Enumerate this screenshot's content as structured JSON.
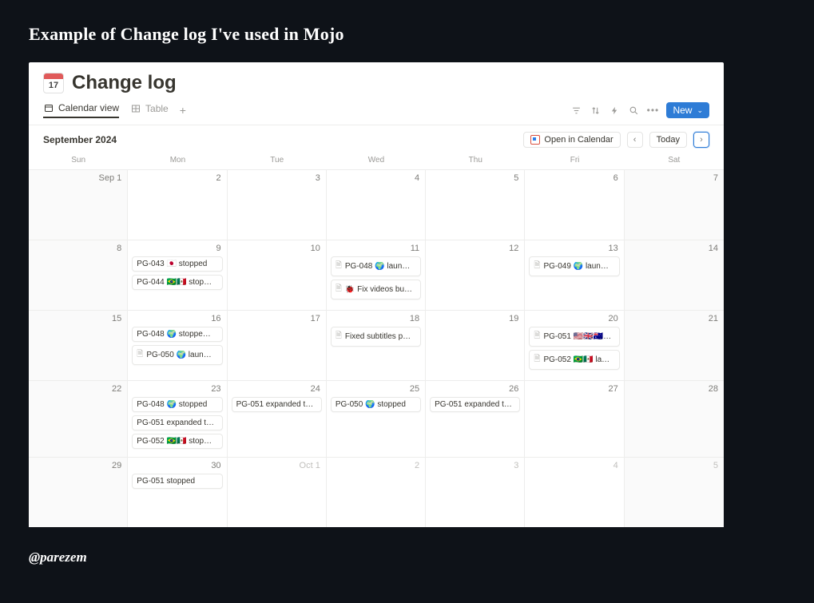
{
  "slide": {
    "title": "Example of Change log I've used in Mojo",
    "handle": "@parezem"
  },
  "page": {
    "icon_day": "17",
    "title": "Change log"
  },
  "views": {
    "calendar": "Calendar view",
    "table": "Table",
    "new_button": "New"
  },
  "toolbar": {
    "open_in_calendar": "Open in Calendar",
    "today": "Today"
  },
  "month": {
    "label": "September 2024"
  },
  "dows": [
    "Sun",
    "Mon",
    "Tue",
    "Wed",
    "Thu",
    "Fri",
    "Sat"
  ],
  "weeks": [
    {
      "days": [
        {
          "label": "Sep 1",
          "we": true,
          "events": []
        },
        {
          "label": "2",
          "events": []
        },
        {
          "label": "3",
          "events": []
        },
        {
          "label": "4",
          "events": []
        },
        {
          "label": "5",
          "events": []
        },
        {
          "label": "6",
          "events": []
        },
        {
          "label": "7",
          "we": true,
          "events": []
        }
      ]
    },
    {
      "days": [
        {
          "label": "8",
          "we": true,
          "events": []
        },
        {
          "label": "9",
          "events": [
            {
              "text": "PG-043 🇯🇵 stopped"
            },
            {
              "text": "PG-044 🇧🇷🇲🇽 stop…"
            }
          ]
        },
        {
          "label": "10",
          "events": []
        },
        {
          "label": "11",
          "events": [
            {
              "icon": true,
              "text": "PG-048 🌍 laun…"
            },
            {
              "icon": true,
              "text": "🐞 Fix videos bu…"
            }
          ]
        },
        {
          "label": "12",
          "events": []
        },
        {
          "label": "13",
          "events": [
            {
              "icon": true,
              "text": "PG-049 🌍 laun…"
            }
          ]
        },
        {
          "label": "14",
          "we": true,
          "events": []
        }
      ]
    },
    {
      "days": [
        {
          "label": "15",
          "we": true,
          "events": []
        },
        {
          "label": "16",
          "events": [
            {
              "text": "PG-048 🌍 stoppe…"
            },
            {
              "icon": true,
              "text": "PG-050 🌍 laun…"
            }
          ]
        },
        {
          "label": "17",
          "events": []
        },
        {
          "label": "18",
          "events": [
            {
              "icon": true,
              "text": "Fixed subtitles p…"
            }
          ]
        },
        {
          "label": "19",
          "events": []
        },
        {
          "label": "20",
          "events": [
            {
              "icon": true,
              "text": "PG-051 🇺🇸🇬🇧🇦🇺…"
            },
            {
              "icon": true,
              "text": "PG-052 🇧🇷🇲🇽 la…"
            }
          ]
        },
        {
          "label": "21",
          "we": true,
          "events": []
        }
      ]
    },
    {
      "days": [
        {
          "label": "22",
          "we": true,
          "events": []
        },
        {
          "label": "23",
          "events": [
            {
              "text": "PG-048 🌍 stopped"
            },
            {
              "text": "PG-051 expanded t…"
            },
            {
              "text": "PG-052 🇧🇷🇲🇽 stop…"
            }
          ]
        },
        {
          "label": "24",
          "events": [
            {
              "text": "PG-051 expanded t…"
            }
          ]
        },
        {
          "label": "25",
          "events": [
            {
              "text": "PG-050 🌍 stopped"
            }
          ]
        },
        {
          "label": "26",
          "events": [
            {
              "text": "PG-051 expanded t…"
            }
          ]
        },
        {
          "label": "27",
          "events": []
        },
        {
          "label": "28",
          "we": true,
          "events": []
        }
      ]
    },
    {
      "days": [
        {
          "label": "29",
          "we": true,
          "events": []
        },
        {
          "label": "30",
          "events": [
            {
              "text": "PG-051 stopped"
            }
          ]
        },
        {
          "label": "Oct 1",
          "dim": true,
          "events": []
        },
        {
          "label": "2",
          "dim": true,
          "events": []
        },
        {
          "label": "3",
          "dim": true,
          "events": []
        },
        {
          "label": "4",
          "dim": true,
          "events": []
        },
        {
          "label": "5",
          "dim": true,
          "we": true,
          "events": []
        }
      ]
    }
  ]
}
